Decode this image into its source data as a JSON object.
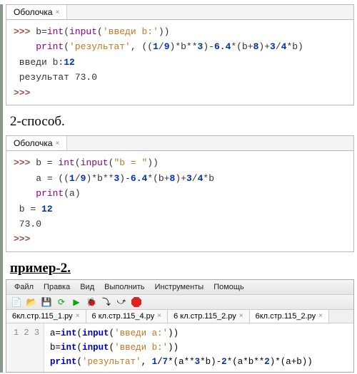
{
  "shell1": {
    "tab": "Оболочка",
    "line1_prompt": ">>>",
    "line1_code_a": " b=",
    "line1_code_fn1": "int",
    "line1_code_b": "(",
    "line1_code_fn2": "input",
    "line1_code_c": "(",
    "line1_code_str": "'введи b:'",
    "line1_code_d": "))",
    "line2_indent": "    ",
    "line2_fn": "print",
    "line2_a": "(",
    "line2_str": "'результат'",
    "line2_b": ", ((",
    "line2_n1": "1",
    "line2_c": "/",
    "line2_n2": "9",
    "line2_d": ")*b**",
    "line2_n3": "3",
    "line2_e": ")-",
    "line2_n4": "6.4",
    "line2_f": "*(b+",
    "line2_n5": "8",
    "line2_g": ")+",
    "line2_n6": "3",
    "line2_h": "/",
    "line2_n7": "4",
    "line2_i": "*b)",
    "out1": " введи b:",
    "out1_val": "12",
    "out2": " результат 73.0",
    "end_prompt": ">>>"
  },
  "heading1": "2-способ.",
  "shell2": {
    "tab": "Оболочка",
    "l1_prompt": ">>>",
    "l1_a": " b = ",
    "l1_fn1": "int",
    "l1_b": "(",
    "l1_fn2": "input",
    "l1_c": "(",
    "l1_str": "\"b = \"",
    "l1_d": "))",
    "l2_indent": "    ",
    "l2_a": "a = ((",
    "l2_n1": "1",
    "l2_b": "/",
    "l2_n2": "9",
    "l2_c": ")*b**",
    "l2_n3": "3",
    "l2_d": ")-",
    "l2_n4": "6.4",
    "l2_e": "*(b+",
    "l2_n5": "8",
    "l2_f": ")+",
    "l2_n6": "3",
    "l2_g": "/",
    "l2_n7": "4",
    "l2_h": "*b",
    "l3_indent": "    ",
    "l3_fn": "print",
    "l3_a": "(a)",
    "out1": " b = ",
    "out1_val": "12",
    "out2": " 73.0",
    "end_prompt": ">>>"
  },
  "heading2": "пример-2.",
  "editor": {
    "menu": [
      "Файл",
      "Правка",
      "Вид",
      "Выполнить",
      "Инструменты",
      "Помощь"
    ],
    "tabs": [
      "6кл.стр.115_1.py",
      "6 кл.стр.115_4.py",
      "6 кл.стр.115_2.ру",
      "6кл.стр.115_2.ру"
    ],
    "active_tab": 3,
    "gutter": [
      "1",
      "2",
      "3"
    ],
    "line1_a": "a=",
    "line1_fn1": "int",
    "line1_b": "(",
    "line1_fn2": "input",
    "line1_c": "(",
    "line1_str": "'введи a:'",
    "line1_d": "))",
    "line2_a": "b=",
    "line2_fn1": "int",
    "line2_b": "(",
    "line2_fn2": "input",
    "line2_c": "(",
    "line2_str": "'введи b:'",
    "line2_d": "))",
    "line3_fn": "print",
    "line3_a": "(",
    "line3_str": "'результат'",
    "line3_b": ", ",
    "line3_n1": "1",
    "line3_c": "/",
    "line3_n2": "7",
    "line3_d": "*(a**",
    "line3_n3": "3",
    "line3_e": "*b)-",
    "line3_n4": "2",
    "line3_f": "*(a*b**",
    "line3_n5": "2",
    "line3_g": ")*(a+b))"
  }
}
